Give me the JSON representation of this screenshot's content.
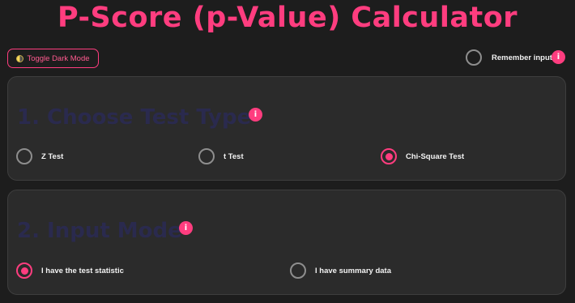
{
  "title": "P-Score (p-Value) Calculator",
  "toggle_button": {
    "label": "Toggle Dark Mode",
    "icon": "half-moon-icon"
  },
  "remember": {
    "label": "Remember inputs",
    "checked": false,
    "info": "i"
  },
  "section1": {
    "heading": "1. Choose Test Type",
    "info": "i",
    "options": [
      {
        "label": "Z Test",
        "selected": false
      },
      {
        "label": "t Test",
        "selected": false
      },
      {
        "label": "Chi-Square Test",
        "selected": true
      }
    ]
  },
  "section2": {
    "heading": "2. Input Mode",
    "info": "i",
    "options": [
      {
        "label": "I have the test statistic",
        "selected": true
      },
      {
        "label": "I have summary data",
        "selected": false
      }
    ]
  },
  "colors": {
    "accent": "#ff3d7f",
    "background": "#1d1d1d",
    "card": "#2b2b2b",
    "heading": "#2a2a4e"
  }
}
